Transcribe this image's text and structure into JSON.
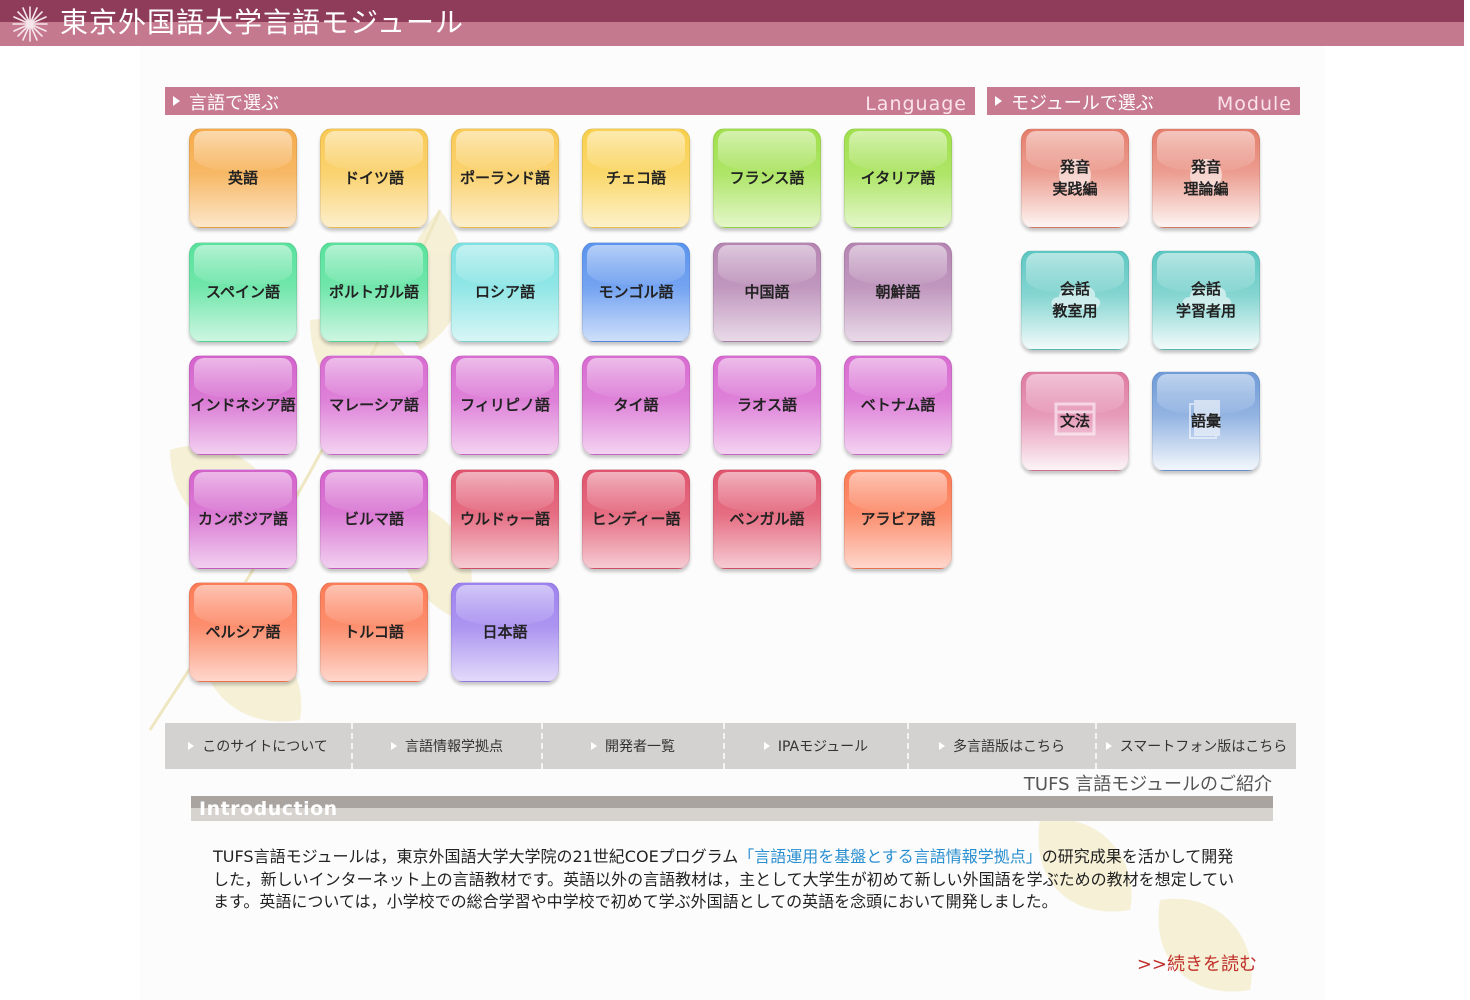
{
  "header": {
    "title": "東京外国語大学言語モジュール"
  },
  "sections": {
    "language": {
      "title": "言語で選ぶ",
      "subtitle": "Language"
    },
    "module": {
      "title": "モジュールで選ぶ",
      "subtitle": "Module"
    }
  },
  "languages": [
    {
      "label": "英語",
      "color": "#f5ab4a"
    },
    {
      "label": "ドイツ語",
      "color": "#f9ca55"
    },
    {
      "label": "ポーランド語",
      "color": "#f9ca55"
    },
    {
      "label": "チェコ語",
      "color": "#f9d04e"
    },
    {
      "label": "フランス語",
      "color": "#a0e04c"
    },
    {
      "label": "イタリア語",
      "color": "#a0e04c"
    },
    {
      "label": "スペイン語",
      "color": "#58e29c"
    },
    {
      "label": "ポルトガル語",
      "color": "#58e29c"
    },
    {
      "label": "ロシア語",
      "color": "#7ee1e1"
    },
    {
      "label": "モンゴル語",
      "color": "#5b93ee"
    },
    {
      "label": "中国語",
      "color": "#b585b2"
    },
    {
      "label": "朝鮮語",
      "color": "#b585b2"
    },
    {
      "label": "インドネシア語",
      "color": "#d462cc"
    },
    {
      "label": "マレーシア語",
      "color": "#d86bd1"
    },
    {
      "label": "フィリピノ語",
      "color": "#d86bd1"
    },
    {
      "label": "タイ語",
      "color": "#d86bd1"
    },
    {
      "label": "ラオス語",
      "color": "#d86bd1"
    },
    {
      "label": "ベトナム語",
      "color": "#d86bd1"
    },
    {
      "label": "カンボジア語",
      "color": "#d462cc"
    },
    {
      "label": "ビルマ語",
      "color": "#d462cc"
    },
    {
      "label": "ウルドゥー語",
      "color": "#e0536c"
    },
    {
      "label": "ヒンディー語",
      "color": "#e0536c"
    },
    {
      "label": "ベンガル語",
      "color": "#e0536c"
    },
    {
      "label": "アラビア語",
      "color": "#fc7b55"
    },
    {
      "label": "ペルシア語",
      "color": "#fc7b55"
    },
    {
      "label": "トルコ語",
      "color": "#fc7b55"
    },
    {
      "label": "日本語",
      "color": "#9d82ee"
    }
  ],
  "modules": [
    {
      "line1": "発音",
      "line2": "実践編",
      "icon": "speech-icon",
      "color": "#e57e6c"
    },
    {
      "line1": "発音",
      "line2": "理論編",
      "icon": "speech-icon",
      "color": "#e57e6c"
    },
    {
      "line1": "会話",
      "line2": "教室用",
      "icon": "chat-cloud-icon",
      "color": "#5cc7c2"
    },
    {
      "line1": "会話",
      "line2": "学習者用",
      "icon": "chat-cloud-icon",
      "color": "#5cc7c2"
    },
    {
      "line1": "文法",
      "line2": "",
      "icon": "calendar-icon",
      "color": "#df7aa1"
    },
    {
      "line1": "語彙",
      "line2": "",
      "icon": "book-icon",
      "color": "#6f9bd8"
    }
  ],
  "nav": [
    "このサイトについて",
    "言語情報学拠点",
    "開発者一覧",
    "IPAモジュール",
    "多言語版はこちら",
    "スマートフォン版はこちら"
  ],
  "intro": {
    "caption": "TUFS 言語モジュールのご紹介",
    "heading": "Introduction",
    "text_before": "TUFS言語モジュールは，東京外国語大学大学院の21世紀COEプログラム",
    "link": "「言語運用を基盤とする言語情報学拠点」",
    "text_after": "の研究成果を活かして開発した，新しいインターネット上の言語教材です。英語以外の言語教材は，主として大学生が初めて新しい外国語を学ぶための教材を想定しています。英語については，小学校での総合学習や中学校で初めて学ぶ外国語としての英語を念頭において開発しました。",
    "more": ">>続きを読む"
  }
}
